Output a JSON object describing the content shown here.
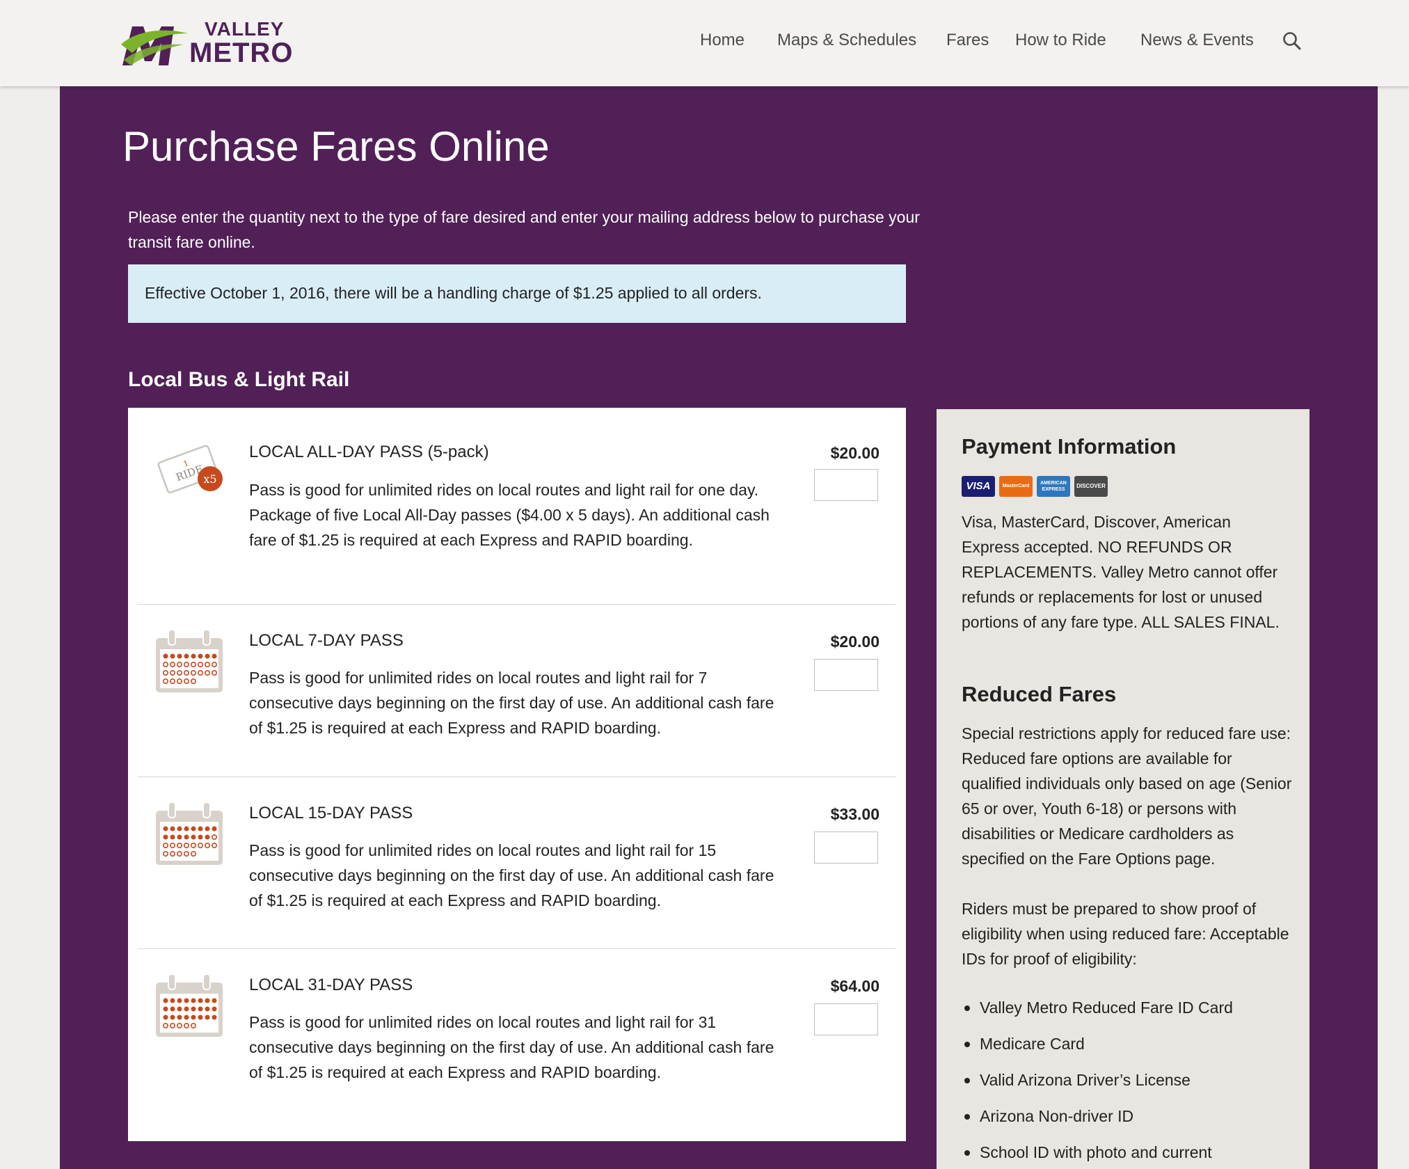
{
  "brand": {
    "logo_line1": "VALLEY",
    "logo_line2": "METRO",
    "purple": "#502057",
    "green": "#7bb42a"
  },
  "nav": {
    "items": [
      "Home",
      "Maps & Schedules",
      "Fares",
      "How to Ride",
      "News & Events"
    ],
    "search_icon": "search-icon"
  },
  "page": {
    "title": "Purchase Fares Online",
    "intro": "Please enter the quantity next to the type of fare desired and enter your mailing address below to purchase your transit fare online.",
    "notice": "Effective October 1, 2016, there will be a handling charge of $1.25 applied to all orders.",
    "section_title": "Local Bus & Light Rail"
  },
  "fares": [
    {
      "name": "LOCAL ALL-DAY PASS (5-pack)",
      "description": "Pass is good for unlimited rides on local routes and light rail for one day. Package of five Local All-Day passes ($4.00 x 5 days). An additional cash fare of $1.25 is required at each Express and RAPID boarding.",
      "price": "$20.00",
      "quantity": "",
      "icon": "ticket-5-pack-icon",
      "icon_ticket_text": "RIDE",
      "icon_ticket_number": "1",
      "icon_badge": "x5"
    },
    {
      "name": "LOCAL 7-DAY PASS",
      "description": "Pass is good for unlimited rides on local routes and light rail for 7 consecutive days beginning on the first day of use. An additional cash fare of $1.25 is required at each Express and RAPID boarding.",
      "price": "$20.00",
      "quantity": "",
      "icon": "calendar-icon"
    },
    {
      "name": "LOCAL 15-DAY PASS",
      "description": "Pass is good for unlimited rides on local routes and light rail for 15 consecutive days beginning on the first day of use. An additional cash fare of $1.25 is required at each Express and RAPID boarding.",
      "price": "$33.00",
      "quantity": "",
      "icon": "calendar-icon"
    },
    {
      "name": "LOCAL 31-DAY PASS",
      "description": "Pass is good for unlimited rides on local routes and light rail for 31 consecutive days beginning on the first day of use. An additional cash fare of $1.25 is required at each Express and RAPID boarding.",
      "price": "$64.00",
      "quantity": "",
      "icon": "calendar-icon"
    }
  ],
  "sidebar": {
    "payment_title": "Payment Information",
    "cards": [
      "VISA",
      "MasterCard",
      "AMERICAN EXPRESS",
      "DISCOVER"
    ],
    "payment_text": "Visa, MasterCard, Discover, American Express accepted. NO REFUNDS OR REPLACEMENTS. Valley Metro cannot offer refunds or replacements for lost or unused portions of any fare type. ALL SALES FINAL.",
    "reduced_title": "Reduced Fares",
    "reduced_text1": "Special restrictions apply for reduced fare use: Reduced fare options are available for qualified individuals only based on age (Senior 65 or over, Youth 6-18) or persons with disabilities or Medicare cardholders as specified on the Fare Options page.",
    "reduced_text2": "Riders must be prepared to show proof of eligibility when using reduced fare: Acceptable IDs for proof of eligibility:",
    "id_list": [
      "Valley Metro Reduced Fare ID Card",
      "Medicare Card",
      "Valid Arizona Driver’s License",
      "Arizona Non-driver ID",
      "School ID with photo and current"
    ]
  }
}
